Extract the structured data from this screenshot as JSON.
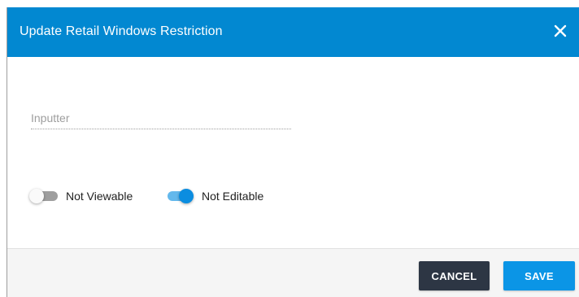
{
  "dialog": {
    "title": "Update Retail Windows Restriction",
    "close_icon": "close-icon"
  },
  "form": {
    "inputter": {
      "value": "",
      "placeholder": "Inputter"
    },
    "toggles": [
      {
        "label": "Not Viewable",
        "checked": false
      },
      {
        "label": "Not Editable",
        "checked": true
      }
    ]
  },
  "footer": {
    "cancel_label": "CANCEL",
    "save_label": "SAVE"
  },
  "colors": {
    "header": "#0288d1",
    "accent": "#0b95e6",
    "cancel": "#2d3644",
    "footer_bg": "#f5f5f5"
  }
}
